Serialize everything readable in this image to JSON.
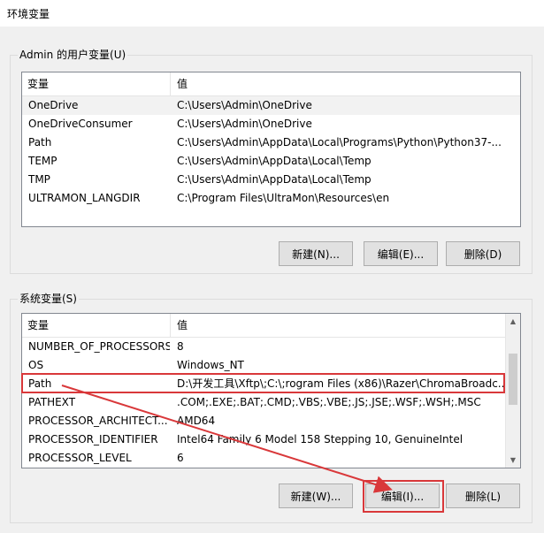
{
  "window": {
    "title": "环境变量"
  },
  "user_vars": {
    "group_label": "Admin 的用户变量(U)",
    "columns": {
      "name": "变量",
      "value": "值"
    },
    "rows": [
      {
        "name": "OneDrive",
        "value": "C:\\Users\\Admin\\OneDrive"
      },
      {
        "name": "OneDriveConsumer",
        "value": "C:\\Users\\Admin\\OneDrive"
      },
      {
        "name": "Path",
        "value": "C:\\Users\\Admin\\AppData\\Local\\Programs\\Python\\Python37-..."
      },
      {
        "name": "TEMP",
        "value": "C:\\Users\\Admin\\AppData\\Local\\Temp"
      },
      {
        "name": "TMP",
        "value": "C:\\Users\\Admin\\AppData\\Local\\Temp"
      },
      {
        "name": "ULTRAMON_LANGDIR",
        "value": "C:\\Program Files\\UltraMon\\Resources\\en"
      }
    ],
    "buttons": {
      "new": "新建(N)...",
      "edit": "编辑(E)...",
      "delete": "删除(D)"
    }
  },
  "system_vars": {
    "group_label": "系统变量(S)",
    "columns": {
      "name": "变量",
      "value": "值"
    },
    "rows": [
      {
        "name": "NUMBER_OF_PROCESSORS",
        "value": "8"
      },
      {
        "name": "OS",
        "value": "Windows_NT"
      },
      {
        "name": "Path",
        "value": "D:\\开发工具\\Xftp\\;C:\\;rogram Files (x86)\\Razer\\ChromaBroadc..."
      },
      {
        "name": "PATHEXT",
        "value": ".COM;.EXE;.BAT;.CMD;.VBS;.VBE;.JS;.JSE;.WSF;.WSH;.MSC"
      },
      {
        "name": "PROCESSOR_ARCHITECT...",
        "value": "AMD64"
      },
      {
        "name": "PROCESSOR_IDENTIFIER",
        "value": "Intel64 Family 6 Model 158 Stepping 10, GenuineIntel"
      },
      {
        "name": "PROCESSOR_LEVEL",
        "value": "6"
      }
    ],
    "buttons": {
      "new": "新建(W)...",
      "edit": "编辑(I)...",
      "delete": "删除(L)"
    }
  },
  "colors": {
    "annotation": "#d9383a",
    "selection": "#f2f2f2"
  }
}
